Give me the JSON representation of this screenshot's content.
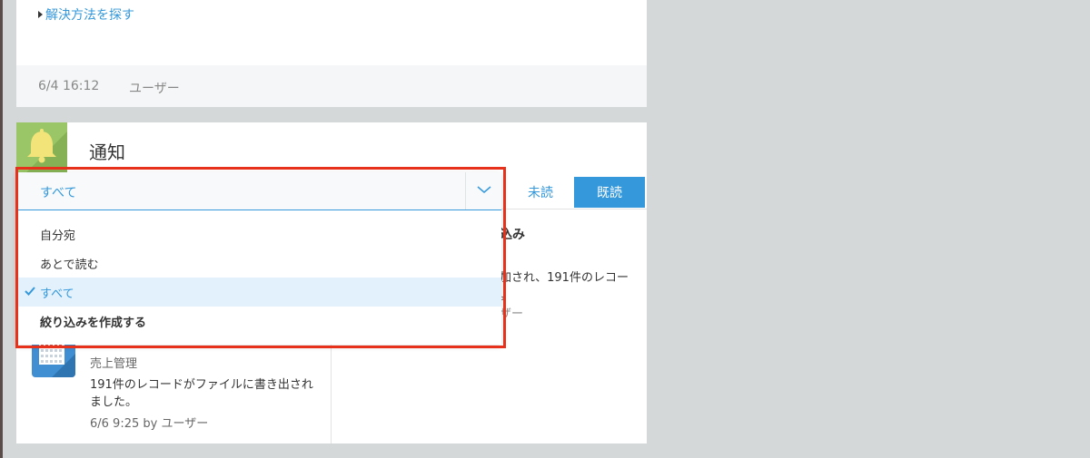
{
  "top_card": {
    "link_text": "解決方法を探す",
    "footer_time": "6/4 16:12",
    "footer_user": "ユーザー"
  },
  "notifications": {
    "title": "通知",
    "tabs": {
      "unread": "未読",
      "read": "既読"
    },
    "filter": {
      "selected": "すべて",
      "options": [
        "自分宛",
        "あとで読む",
        "すべて"
      ],
      "create_label": "絞り込みを作成する"
    },
    "right_item": {
      "title_fragment": "込み",
      "message_fragment": "加され、191件のレコー",
      "message_fragment2": "。",
      "user_fragment": "ザー"
    },
    "item": {
      "app_name": "売上管理",
      "message": "191件のレコードがファイルに書き出されました。",
      "meta": "6/6 9:25  by ユーザー"
    }
  },
  "colors": {
    "accent": "#3498db",
    "highlight_border": "#e8311a",
    "notif_icon_bg": "#9ac667",
    "bell": "#f3e47a",
    "app_icon_bg": "#3f8fd2"
  }
}
